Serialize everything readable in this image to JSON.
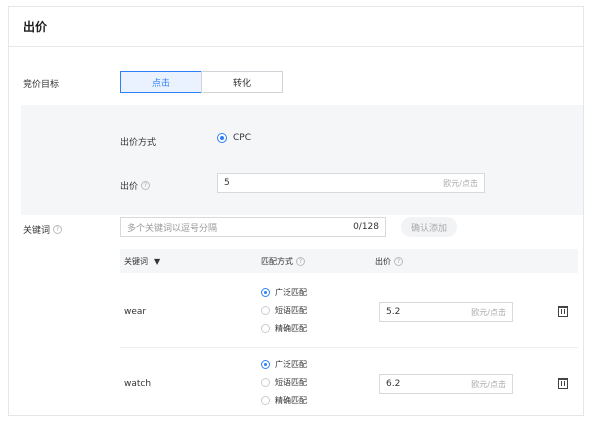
{
  "header": {
    "title": "出价"
  },
  "bid_target": {
    "label": "竞价目标",
    "options": [
      {
        "label": "点击",
        "active": true
      },
      {
        "label": "转化",
        "active": false
      }
    ]
  },
  "bid_method": {
    "label": "出价方式",
    "value": "CPC"
  },
  "bid": {
    "label": "出价",
    "value": "5",
    "unit": "欧元/点击"
  },
  "keywords": {
    "label": "关键词",
    "input_placeholder": "多个关键词以逗号分隔",
    "count": "0/128",
    "add_button": "确认添加",
    "columns": {
      "keyword": "关键词",
      "match": "匹配方式",
      "bid": "出价"
    },
    "rows": [
      {
        "keyword": "wear",
        "match_options": [
          "广泛匹配",
          "短语匹配",
          "精确匹配"
        ],
        "selected": 0,
        "bid": "5.2",
        "unit": "欧元/点击"
      },
      {
        "keyword": "watch",
        "match_options": [
          "广泛匹配",
          "短语匹配",
          "精确匹配"
        ],
        "selected": 0,
        "bid": "6.2",
        "unit": "欧元/点击"
      }
    ]
  }
}
